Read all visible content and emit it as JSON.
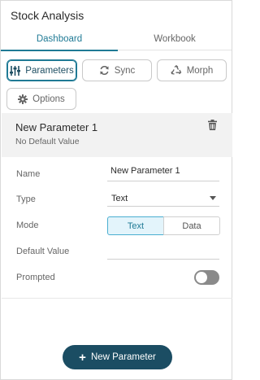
{
  "app": {
    "title": "Stock Analysis"
  },
  "tabs": [
    {
      "label": "Dashboard",
      "active": true
    },
    {
      "label": "Workbook",
      "active": false
    }
  ],
  "toolbar": {
    "parameters_label": "Parameters",
    "sync_label": "Sync",
    "morph_label": "Morph",
    "options_label": "Options"
  },
  "parameter": {
    "title": "New Parameter 1",
    "subtitle": "No Default Value"
  },
  "form": {
    "name_label": "Name",
    "name_value": "New Parameter 1",
    "type_label": "Type",
    "type_value": "Text",
    "mode_label": "Mode",
    "mode_options": [
      "Text",
      "Data"
    ],
    "mode_selected": "Text",
    "default_label": "Default Value",
    "default_value": "",
    "prompted_label": "Prompted",
    "prompted_on": false
  },
  "footer": {
    "new_parameter_label": "New Parameter"
  },
  "colors": {
    "accent": "#1f7a95",
    "primary_button": "#1b4d63",
    "toggle_off": "#8a8a8a",
    "segment_active_bg": "#e3f4fb"
  },
  "icons": {
    "parameters": "sliders-icon",
    "sync": "sync-icon",
    "morph": "recycle-icon",
    "options": "gear-icon",
    "delete": "trash-icon",
    "add": "plus-icon"
  }
}
